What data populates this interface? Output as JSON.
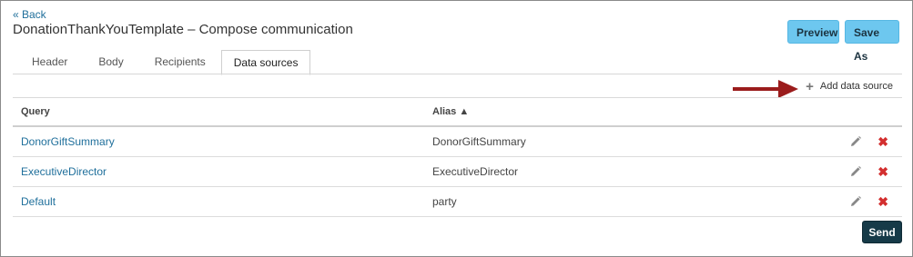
{
  "header": {
    "back_label": "« Back",
    "title": "DonationThankYouTemplate – Compose communication",
    "preview_label": "Preview",
    "save_as_label": "Save As"
  },
  "tabs": [
    {
      "label": "Header",
      "active": false
    },
    {
      "label": "Body",
      "active": false
    },
    {
      "label": "Recipients",
      "active": false
    },
    {
      "label": "Data sources",
      "active": true
    }
  ],
  "actions": {
    "add_data_source_label": "Add data source",
    "add_icon": "plus-icon",
    "annotation_arrow_color": "#9b1c1c"
  },
  "table": {
    "columns": {
      "query": "Query",
      "alias": "Alias ▲"
    },
    "rows": [
      {
        "query": "DonorGiftSummary",
        "alias": "DonorGiftSummary"
      },
      {
        "query": "ExecutiveDirector",
        "alias": "ExecutiveDirector"
      },
      {
        "query": "Default",
        "alias": "party"
      }
    ],
    "row_icons": [
      "pencil-icon",
      "delete-x-icon"
    ]
  },
  "footer": {
    "send_label": "Send"
  },
  "colors": {
    "link": "#1f6f9b",
    "button_light": "#6dc7ef",
    "button_dark": "#163a48",
    "delete": "#d32f2f"
  }
}
